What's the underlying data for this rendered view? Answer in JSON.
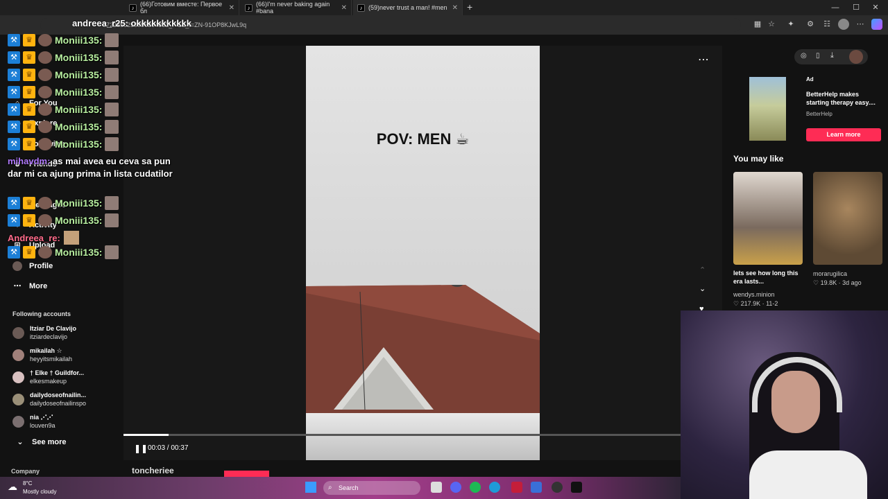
{
  "browser": {
    "tabs": [
      {
        "title": "(66)Готовим вместе: Первое бл",
        "icon": "tiktok-icon"
      },
      {
        "title": "(66)I'm never baking again #bana",
        "icon": "tiktok-icon"
      },
      {
        "title": "(59)never trust a man! #men",
        "icon": "tiktok-icon"
      }
    ],
    "new_tab": "+",
    "url": "6722356250096304862_r=1&_t=ZN-91OP8KJwL9q",
    "window_controls": [
      "—",
      "☐",
      "✕"
    ]
  },
  "sidebar": {
    "nav": [
      {
        "label": "For You",
        "icon": "home-icon"
      },
      {
        "label": "Explore",
        "icon": "compass-icon"
      },
      {
        "label": "Following",
        "icon": "following-icon"
      },
      {
        "label": "Friends",
        "icon": "friends-icon"
      },
      {
        "label": "Messages",
        "icon": "message-icon"
      },
      {
        "label": "Activity",
        "icon": "activity-icon"
      },
      {
        "label": "Upload",
        "icon": "upload-icon"
      },
      {
        "label": "Profile",
        "icon": "profile-icon"
      },
      {
        "label": "More",
        "icon": "more-icon"
      }
    ],
    "following_header": "Following accounts",
    "accounts": [
      {
        "name": "Itziar De Clavijo",
        "handle": "itziardeclavijo"
      },
      {
        "name": "mikailah ☆",
        "handle": "heyyitsmikailah"
      },
      {
        "name": "† Elke † Guildfor...",
        "handle": "elkesmakeup"
      },
      {
        "name": "dailydoseofnailin...",
        "handle": "dailydoseofnailinspo"
      },
      {
        "name": "nia ⋰⋰",
        "handle": "louven9a"
      }
    ],
    "see_more": "See more",
    "company": "Company"
  },
  "video": {
    "caption": "POV: MEN ☕",
    "time": "00:03 / 00:37",
    "progress": 0.081,
    "author": "toncheriee"
  },
  "ad": {
    "tag": "Ad",
    "title": "BetterHelp makes starting therapy easy....",
    "brand": "BetterHelp",
    "cta": "Learn more"
  },
  "recommendations": {
    "header": "You may like",
    "items": [
      {
        "title": "lets see how long this era lasts...",
        "author": "wendys.minion",
        "likes": "♡ 217.9K",
        "date": "11-2"
      },
      {
        "title": "",
        "author": "morarugilica",
        "likes": "♡ 19.8K",
        "date": "3d ago"
      }
    ]
  },
  "chat": {
    "top_message": "andreea_r25: okkkkkkkkkkk",
    "repeated_nick": "Moniii135:",
    "long_nick": "mihavdm:",
    "long_message": "as mai avea eu ceva sa pun dar mi ca ajung prima in lista cudatilor",
    "andreea_nick": "Andreea_re:"
  },
  "taskbar": {
    "temp": "8°C",
    "weather": "Mostly cloudy",
    "search": "Search"
  },
  "colors": {
    "accent": "#fe2c55",
    "chat_nick": "#b9f0a1",
    "chat_nick2": "#b27bff"
  }
}
